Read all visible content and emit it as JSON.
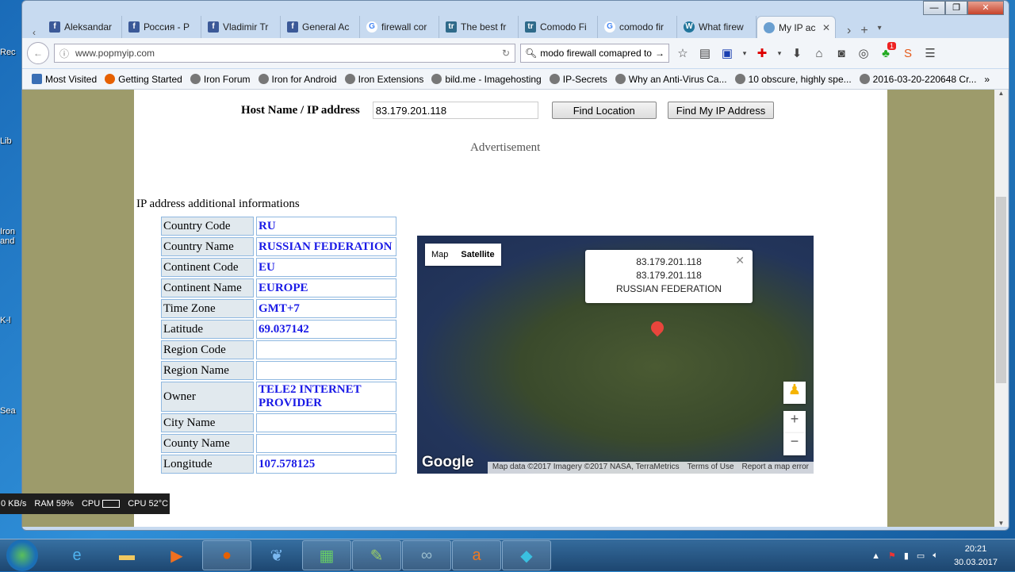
{
  "desktop": {
    "icons": [
      "Rec",
      "Lib",
      "Iron and",
      "K-l",
      "Sea"
    ]
  },
  "browser": {
    "tabs": [
      {
        "label": "Aleksandar",
        "icon": "facebook"
      },
      {
        "label": "Россия - Р",
        "icon": "facebook"
      },
      {
        "label": "Vladimir Tr",
        "icon": "facebook"
      },
      {
        "label": "General Ac",
        "icon": "facebook"
      },
      {
        "label": "firewall cor",
        "icon": "google"
      },
      {
        "label": "The best fr",
        "icon": "tr"
      },
      {
        "label": "Comodo Fi",
        "icon": "tr"
      },
      {
        "label": "comodo fir",
        "icon": "google"
      },
      {
        "label": "What firew",
        "icon": "wordpress"
      },
      {
        "label": "My IP ac",
        "icon": "globe",
        "active": true
      }
    ],
    "url": "www.popmyip.com",
    "search": "modo firewall comapred to",
    "badge": "1",
    "bookmarks": [
      "Most Visited",
      "Getting Started",
      "Iron Forum",
      "Iron for Android",
      "Iron Extensions",
      "bild.me - Imagehosting",
      "IP-Secrets",
      "Why an Anti-Virus Ca...",
      "10 obscure, highly spe...",
      "2016-03-20-220648 Cr..."
    ]
  },
  "page": {
    "host_label": "Host Name / IP address",
    "host_value": "83.179.201.118",
    "find_location": "Find Location",
    "find_my_ip": "Find My IP Address",
    "advertisement": "Advertisement",
    "info_title": "IP address additional informations",
    "rows": [
      {
        "label": "Country Code",
        "value": "RU"
      },
      {
        "label": "Country Name",
        "value": "RUSSIAN FEDERATION"
      },
      {
        "label": "Continent Code",
        "value": "EU"
      },
      {
        "label": "Continent Name",
        "value": "EUROPE"
      },
      {
        "label": "Time Zone",
        "value": "GMT+7"
      },
      {
        "label": "Latitude",
        "value": "69.037142"
      },
      {
        "label": "Region Code",
        "value": ""
      },
      {
        "label": "Region Name",
        "value": ""
      },
      {
        "label": "Owner",
        "value": "TELE2 INTERNET PROVIDER"
      },
      {
        "label": "City Name",
        "value": ""
      },
      {
        "label": "County Name",
        "value": ""
      },
      {
        "label": "Longitude",
        "value": "107.578125"
      }
    ],
    "map": {
      "map_btn": "Map",
      "satellite_btn": "Satellite",
      "popup_line1": "83.179.201.118",
      "popup_line2": "83.179.201.118",
      "popup_line3": "RUSSIAN FEDERATION",
      "logo": "Google",
      "attribution": "Map data ©2017 Imagery ©2017 NASA, TerraMetrics",
      "terms": "Terms of Use",
      "report": "Report a map error",
      "zoom_in": "+",
      "zoom_out": "−"
    }
  },
  "meter": {
    "net": "0 KB/s",
    "ram": "RAM 59%",
    "cpu": "CPU",
    "temp": "CPU 52°C"
  },
  "taskbar": {
    "time": "20:21",
    "date": "30.03.2017"
  }
}
